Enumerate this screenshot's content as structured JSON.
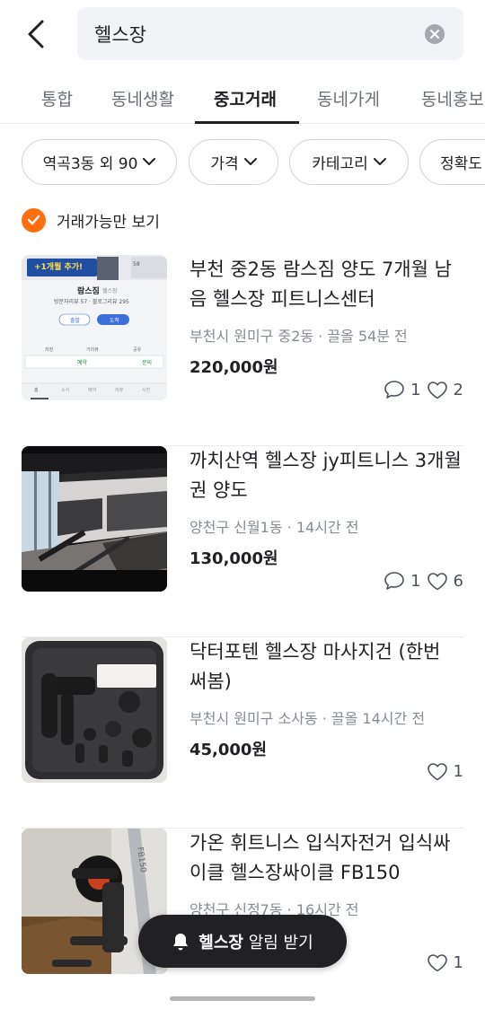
{
  "search": {
    "query": "헬스장"
  },
  "tabs": [
    {
      "label": "통합"
    },
    {
      "label": "동네생활"
    },
    {
      "label": "중고거래"
    },
    {
      "label": "동네가게"
    },
    {
      "label": "동네홍보"
    }
  ],
  "active_tab": "중고거래",
  "filters": [
    {
      "label": "역곡3동 외 90"
    },
    {
      "label": "가격"
    },
    {
      "label": "카테고리"
    },
    {
      "label": "정확도"
    }
  ],
  "availability": {
    "label": "거래가능만 보기",
    "checked": true
  },
  "items": [
    {
      "title": "부천 중2동 람스짐 양도 7개월 남음 헬스장 피트니스센터",
      "meta": "부천시 원미구 중2동 · 끌올 54분 전",
      "price": "220,000원",
      "comments": "1",
      "likes": "2",
      "thumb": {
        "banner": "+1개월 추가!",
        "gym_name": "람스짐",
        "gym_sub": "헬스장",
        "reviews": "방문자리뷰 57 · 블로그리뷰 295",
        "btn_call": "출발",
        "btn_map": "도착",
        "icons": [
          "저장",
          "거리뷰",
          "공유"
        ],
        "reserve": "예약",
        "inquiry": "문의",
        "tabs": [
          "홈",
          "소식",
          "예약",
          "리뷰",
          "사진"
        ],
        "photo_count": "58"
      }
    },
    {
      "title": "까치산역 헬스장 jy피트니스 3개월권 양도",
      "meta": "양천구 신월1동 · 14시간 전",
      "price": "130,000원",
      "comments": "1",
      "likes": "6"
    },
    {
      "title": "닥터포텐 헬스장 마사지건 (한번 써봄)",
      "meta": "부천시 원미구 소사동 · 끌올 14시간 전",
      "price": "45,000원",
      "likes": "1"
    },
    {
      "title": "가온 휘트니스 입식자전거 입식싸이클 헬스장싸이클 FB150",
      "meta": "양천구 신정7동 · 16시간 전",
      "likes": "1",
      "thumb": {
        "label": "FB150"
      }
    }
  ],
  "alert_button": {
    "keyword": "헬스장",
    "suffix": "알림 받기"
  },
  "colors": {
    "accent": "#ff6f0f",
    "text": "#212124",
    "muted": "#868b94"
  }
}
